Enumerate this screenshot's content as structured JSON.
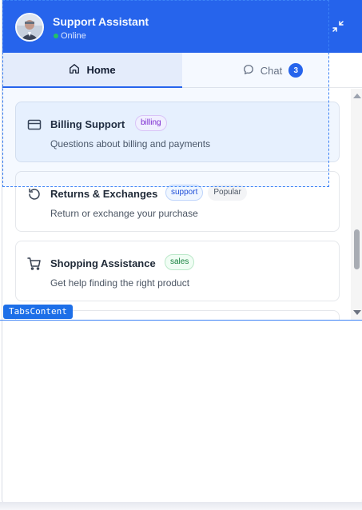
{
  "header": {
    "title": "Support Assistant",
    "status": "Online",
    "avatar_icon": "user-avatar",
    "minimize_icon": "minimize-icon",
    "accent": "#2563eb"
  },
  "tabs": [
    {
      "label": "Home",
      "icon": "home-icon",
      "selected": true
    },
    {
      "label": "Chat",
      "icon": "chat-bubble-icon",
      "count": "3"
    }
  ],
  "topics": [
    {
      "title": "Billing Support",
      "tags": [
        "billing"
      ],
      "description": "Questions about billing and payments",
      "icon": "credit-card-icon"
    },
    {
      "title": "Returns & Exchanges",
      "tags": [
        "support",
        "Popular"
      ],
      "description": "Return or exchange your purchase",
      "icon": "rotate-ccw-icon"
    },
    {
      "title": "Shopping Assistance",
      "tags": [
        "sales"
      ],
      "description": "Get help finding the right product",
      "icon": "shopping-cart-icon"
    }
  ],
  "overlay": {
    "label": "TabsContent"
  }
}
